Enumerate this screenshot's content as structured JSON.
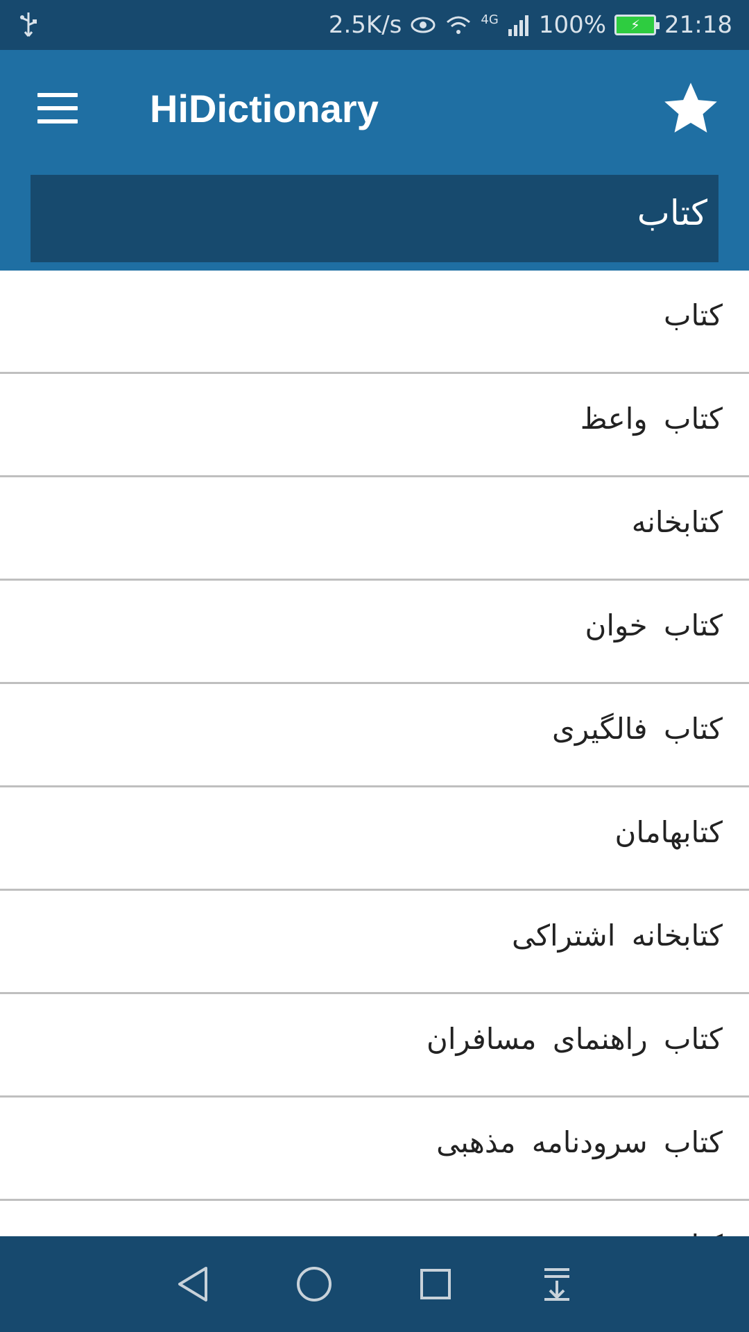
{
  "status_bar": {
    "speed": "2.5K/s",
    "network": "4G",
    "battery": "100%",
    "time": "21:18",
    "battery_color": "#2ecc40"
  },
  "app_bar": {
    "title": "HiDictionary",
    "color": "#1f6fa3",
    "menu_icon": "hamburger-menu-icon",
    "favorite_icon": "star-icon"
  },
  "search": {
    "value": "کتاب"
  },
  "results": [
    "کتاب",
    "کتاب واعظ",
    "کتابخانه",
    "کتاب خوان",
    "کتاب فالگیری",
    "کتابهامان",
    "کتابخانه اشتراکی",
    "کتاب راهنمای مسافران",
    "کتاب سرودنامه مذهبی",
    "کتاب"
  ],
  "nav_bar": {
    "buttons": [
      "back-icon",
      "home-icon",
      "recents-icon",
      "notification-pull-icon"
    ]
  }
}
